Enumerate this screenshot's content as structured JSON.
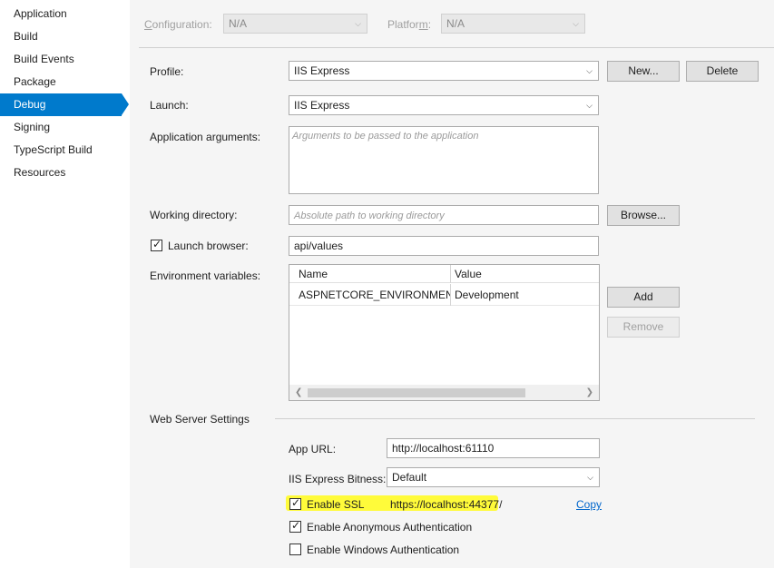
{
  "sidebar": {
    "items": [
      {
        "label": "Application"
      },
      {
        "label": "Build"
      },
      {
        "label": "Build Events"
      },
      {
        "label": "Package"
      },
      {
        "label": "Debug"
      },
      {
        "label": "Signing"
      },
      {
        "label": "TypeScript Build"
      },
      {
        "label": "Resources"
      }
    ],
    "active_index": 4
  },
  "header": {
    "configuration_label_pre": "",
    "configuration_label_underlined": "C",
    "configuration_label_post": "onfiguration:",
    "configuration_value": "N/A",
    "platform_label_pre": "Platfor",
    "platform_label_underlined": "m",
    "platform_label_post": ":",
    "platform_value": "N/A"
  },
  "profile": {
    "label": "Profile:",
    "value": "IIS Express",
    "new_button": "New...",
    "delete_button": "Delete"
  },
  "launch": {
    "label": "Launch:",
    "value": "IIS Express"
  },
  "app_args": {
    "label": "Application arguments:",
    "placeholder": "Arguments to be passed to the application"
  },
  "working_dir": {
    "label": "Working directory:",
    "placeholder": "Absolute path to working directory",
    "browse_button": "Browse..."
  },
  "launch_browser": {
    "label": "Launch browser:",
    "checked": true,
    "value": "api/values"
  },
  "env_vars": {
    "label": "Environment variables:",
    "columns": [
      "Name",
      "Value"
    ],
    "rows": [
      {
        "name": "ASPNETCORE_ENVIRONMENT",
        "value": "Development"
      }
    ],
    "add_button": "Add",
    "remove_button": "Remove"
  },
  "web_server": {
    "section_title": "Web Server Settings",
    "app_url_label": "App URL:",
    "app_url_value": "http://localhost:61110",
    "bitness_label": "IIS Express Bitness:",
    "bitness_value": "Default",
    "enable_ssl_label": "Enable SSL",
    "enable_ssl_checked": true,
    "ssl_url": "https://localhost:44377/",
    "copy_link": "Copy",
    "anon_auth_label": "Enable Anonymous Authentication",
    "anon_auth_checked": true,
    "windows_auth_label": "Enable Windows Authentication",
    "windows_auth_checked": false
  },
  "colors": {
    "accent": "#007acc",
    "highlight": "#fffb3a",
    "link": "#0066cc"
  }
}
